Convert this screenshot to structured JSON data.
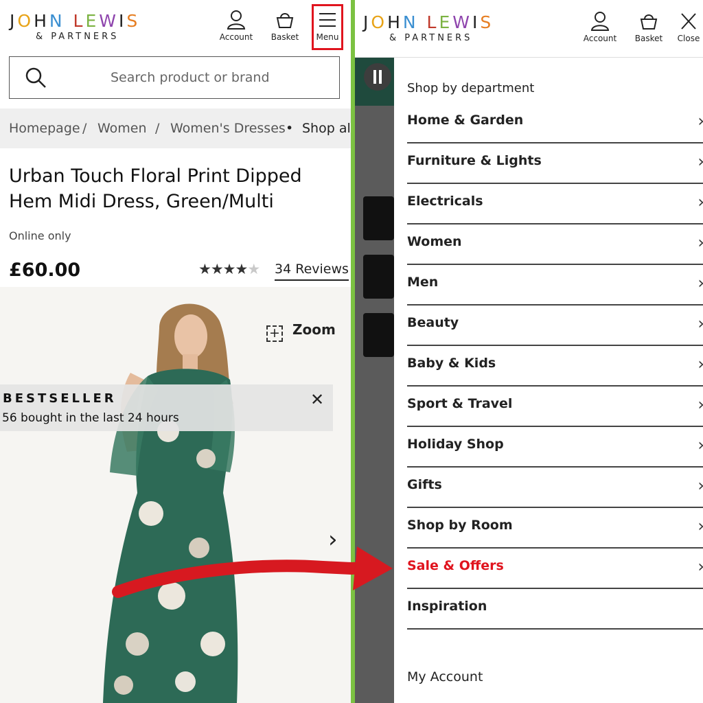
{
  "left": {
    "logo": {
      "brand": "JOHN LEWIS",
      "sub": "& PARTNERS"
    },
    "header": {
      "account": "Account",
      "basket": "Basket",
      "menu": "Menu"
    },
    "search": {
      "placeholder": "Search product or brand"
    },
    "breadcrumb": [
      "Homepage",
      "/",
      "Women",
      "/",
      "Women's Dresses",
      "•",
      "Shop all"
    ],
    "product": {
      "title": "Urban Touch Floral Print Dipped Hem Midi Dress, Green/Multi",
      "availability": "Online only",
      "price": "£60.00",
      "rating": 4,
      "reviews": "34 Reviews"
    },
    "gallery": {
      "zoom": "Zoom"
    },
    "bestseller": {
      "title": "BESTSELLER",
      "text": "56 bought in the last 24 hours"
    }
  },
  "right": {
    "logo": {
      "brand": "JOHN LEWIS",
      "sub": "& PARTNERS"
    },
    "header": {
      "account": "Account",
      "basket": "Basket",
      "close": "Close"
    },
    "menu": {
      "title": "Shop by department",
      "items": [
        "Home & Garden",
        "Furniture & Lights",
        "Electricals",
        "Women",
        "Men",
        "Beauty",
        "Baby & Kids",
        "Sport & Travel",
        "Holiday Shop",
        "Gifts",
        "Shop by Room",
        "Sale & Offers",
        "Inspiration"
      ],
      "my_account": "My Account"
    }
  },
  "colors": {
    "highlight": "#e0141e",
    "divider": "#7cc242",
    "sale": "#e0141e",
    "dress": "#2d6a56"
  }
}
